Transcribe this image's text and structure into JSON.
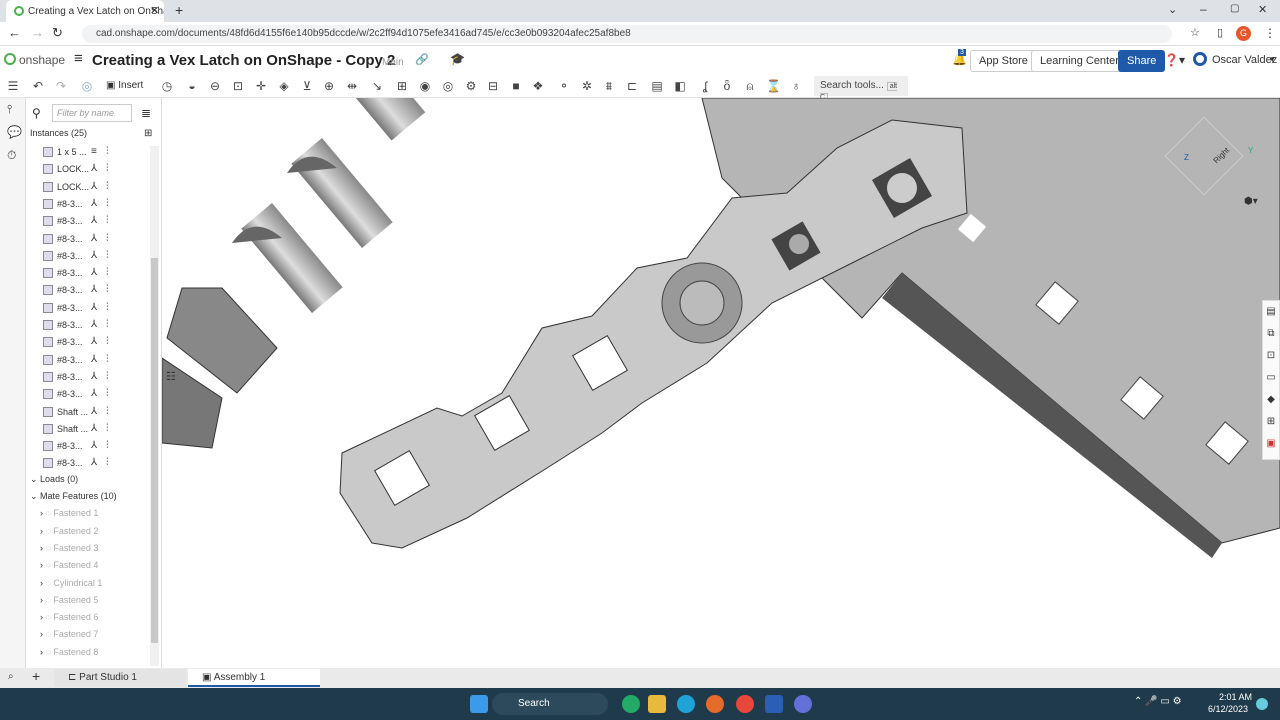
{
  "browser": {
    "tab_title": "Creating a Vex Latch on OnShape",
    "url": "cad.onshape.com/documents/48fd6d4155f6e140b95dccde/w/2c2ff94d1075efe3416ad745/e/cc3e0b093204afec25af8be8",
    "profile_initial": "G"
  },
  "app": {
    "logo": "onshape",
    "doc_title": "Creating a Vex Latch on OnShape - Copy 2",
    "branch": "Main",
    "notif_count": "3",
    "app_store": "App Store",
    "learning_center": "Learning Center",
    "share": "Share",
    "user": "Oscar Valdez",
    "brand_color": "#1e5aa8"
  },
  "toolbar": {
    "insert": "Insert",
    "search": "Search tools...",
    "shortcut": "alt C"
  },
  "panel": {
    "filter_placeholder": "Filter by name",
    "instances_header": "Instances (25)",
    "instances": [
      "1 x 5 ...",
      "LOCK...",
      "LOCK...",
      "#8-3...",
      "#8-3...",
      "#8-3...",
      "#8-3...",
      "#8-3...",
      "#8-3...",
      "#8-3...",
      "#8-3...",
      "#8-3...",
      "#8-3...",
      "#8-3...",
      "#8-3...",
      "Shaft ...",
      "Shaft ...",
      "#8-3...",
      "#8-3..."
    ],
    "loads": "Loads (0)",
    "mates_header": "Mate Features (10)",
    "mates": [
      "Fastened 1",
      "Fastened 2",
      "Fastened 3",
      "Fastened 4",
      "Cylindrical 1",
      "Fastened 5",
      "Fastened 6",
      "Fastened 7",
      "Fastened 8"
    ]
  },
  "viewcube": {
    "face": "Right",
    "x": "Z",
    "y": "Y"
  },
  "bottom_tabs": [
    "Part Studio 1",
    "Assembly 1"
  ],
  "taskbar": {
    "search": "Search",
    "time": "2:01 AM",
    "date": "6/12/2023"
  }
}
